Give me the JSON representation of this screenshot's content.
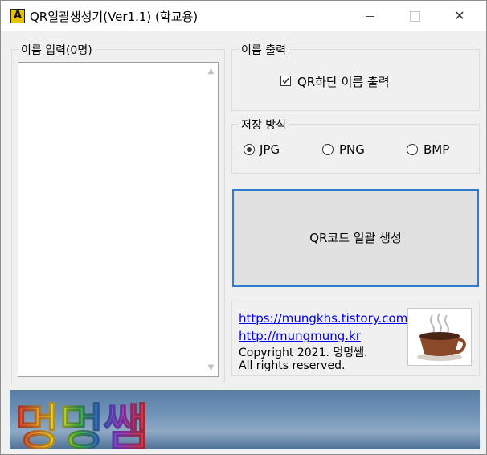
{
  "window": {
    "title": "QR일괄생성기(Ver1.1) (학교용)",
    "icon_letter": "A",
    "controls": {
      "minimize": "minimize-icon",
      "maximize": "maximize-icon",
      "close": "✕"
    }
  },
  "name_input": {
    "group_label": "이름 입력(0명)",
    "value": ""
  },
  "name_output": {
    "group_label": "이름 출력",
    "checkbox_label": "QR하단 이름 출력",
    "checked": true
  },
  "save_format": {
    "group_label": "저장 방식",
    "options": [
      {
        "label": "JPG",
        "selected": true
      },
      {
        "label": "PNG",
        "selected": false
      },
      {
        "label": "BMP",
        "selected": false
      }
    ]
  },
  "generate_button": {
    "label": "QR코드 일괄 생성"
  },
  "info": {
    "link1": "https://mungkhs.tistory.com",
    "link2": "http://mungmung.kr",
    "copyright_line1": "Copyright 2021. 멍멍쌤.",
    "copyright_line2": "All rights reserved.",
    "image": "coffee-cup-icon"
  },
  "banner": {
    "text": "멍멍쌤"
  },
  "colors": {
    "accent_border": "#2e7bd1",
    "link": "#0000ee"
  }
}
